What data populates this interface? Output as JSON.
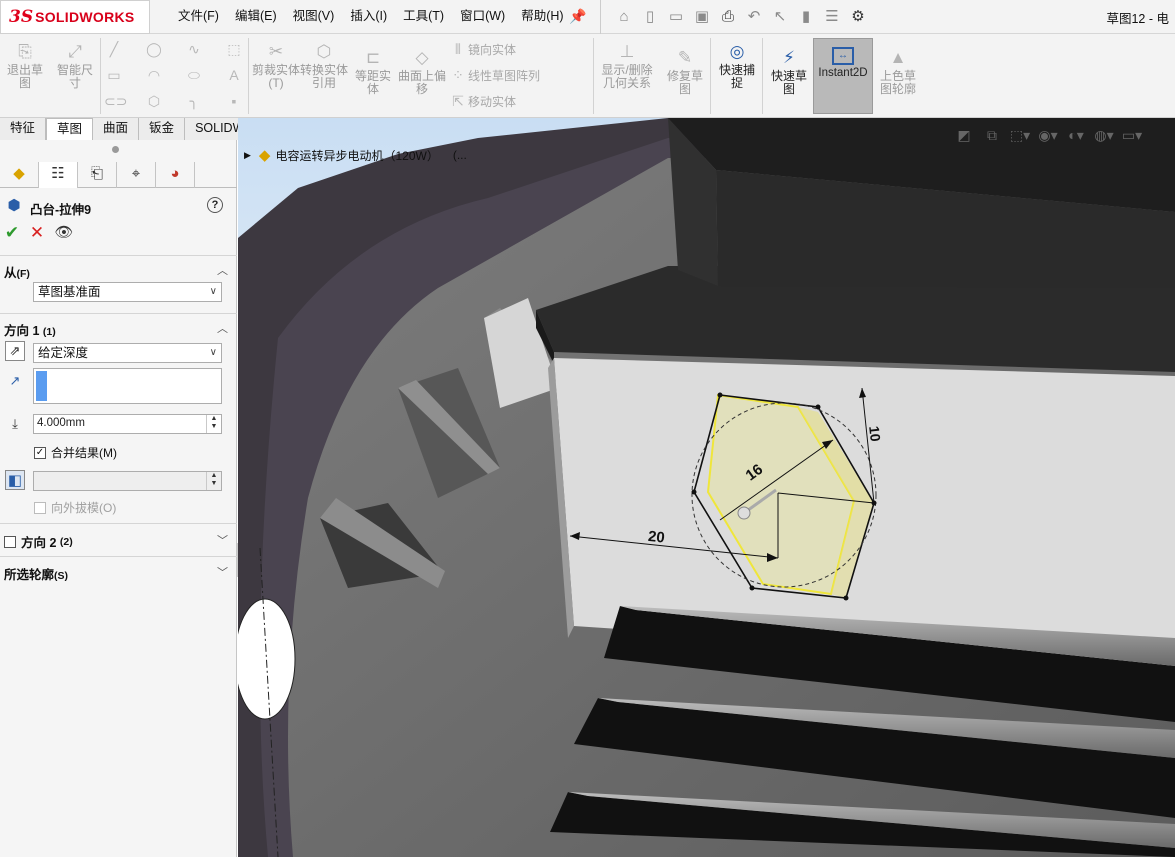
{
  "app": {
    "logo_prefix": "3S",
    "logo_name": "SOLIDWORKS",
    "document_title": "草图12 - 电"
  },
  "menu": [
    "文件(F)",
    "编辑(E)",
    "视图(V)",
    "插入(I)",
    "工具(T)",
    "窗口(W)",
    "帮助(H)"
  ],
  "quick_access_icons": [
    "home-icon",
    "new-document-icon",
    "open-icon",
    "save-icon",
    "print-icon",
    "undo-icon",
    "select-icon",
    "rebuild-icon",
    "file-properties-icon",
    "options-icon"
  ],
  "ribbon": {
    "exit_sketch": "退出草图",
    "smart_dimension": "智能尺寸",
    "trim_entities": "剪裁实体(T)",
    "convert_entities": "转换实体引用",
    "offset_entities": "等距实体",
    "offset_on_surface": "曲面上偏移",
    "mirror_entities": "镜向实体",
    "linear_pattern": "线性草图阵列",
    "move_entities": "移动实体",
    "display_delete_relations": "显示/删除几何关系",
    "repair_sketch": "修复草图",
    "quick_snaps": "快速捕捉",
    "rapid_sketch": "快速草图",
    "instant2d": "Instant2D",
    "shaded_sketch_contours": "上色草图轮廓"
  },
  "tabs": [
    "特征",
    "草图",
    "曲面",
    "钣金",
    "SOLIDWORKS 插件"
  ],
  "active_tab": "草图",
  "property_manager": {
    "title": "凸台-拉伸9",
    "help": "?",
    "from_label": "从",
    "from_key": "(F)",
    "from_value": "草图基准面",
    "dir1_label": "方向 1",
    "dir1_key": "(1)",
    "end_condition": "给定深度",
    "depth": "4.000mm",
    "merge_result": "合并结果(M)",
    "merge_checked": true,
    "draft_outward": "向外拔模(O)",
    "dir2_label": "方向 2",
    "dir2_key": "(2)",
    "selected_contours": "所选轮廓",
    "selected_contours_key": "(S)"
  },
  "feature_tree": {
    "root": "电容运转异步电动机（120W）",
    "suffix": "(..."
  },
  "sketch_dimensions": {
    "diameter": "16",
    "horizontal": "20",
    "vertical": "10"
  },
  "colors": {
    "accent_blue": "#2a5ea8",
    "brand_red": "#d8001a",
    "preview_yellow": "#f2ec6a",
    "ok_green": "#2e9a2e",
    "cancel_red": "#d82020"
  }
}
